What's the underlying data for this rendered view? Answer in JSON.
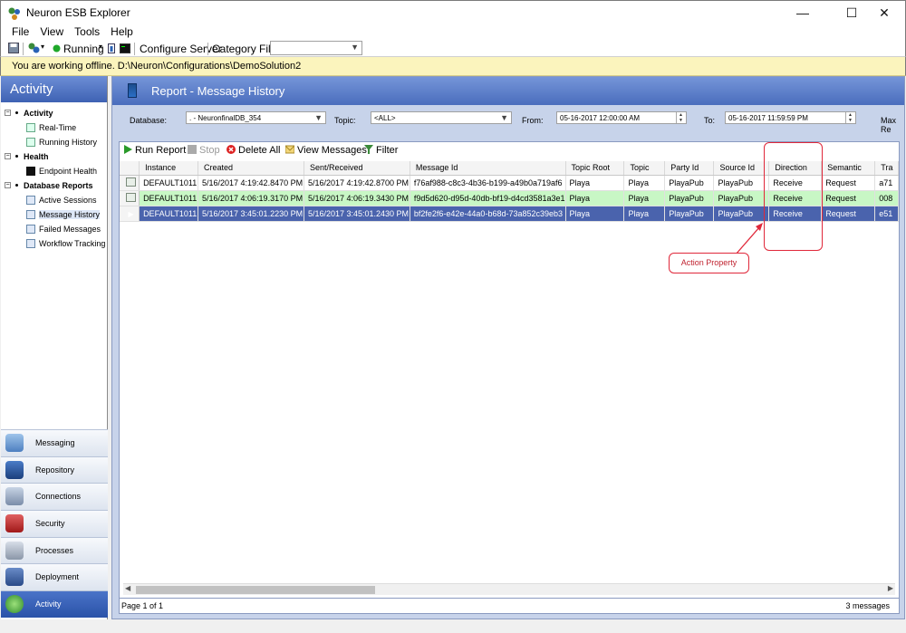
{
  "window": {
    "title": "Neuron ESB Explorer",
    "minimize": "—",
    "maximize": "☐",
    "close": "✕"
  },
  "menu": [
    "File",
    "View",
    "Tools",
    "Help"
  ],
  "toolbar": {
    "status": "Running",
    "configure_server": "Configure Server",
    "category_filter": "Category Filter",
    "category_value": ""
  },
  "offline_banner": "You are working offline. D:\\Neuron\\Configurations\\DemoSolution2",
  "nav": {
    "header": "Activity",
    "groups": [
      {
        "label": "Activity",
        "items": [
          "Real-Time",
          "Running History"
        ]
      },
      {
        "label": "Health",
        "items": [
          "Endpoint Health"
        ]
      },
      {
        "label": "Database Reports",
        "items": [
          "Active Sessions",
          "Message History",
          "Failed Messages",
          "Workflow Tracking"
        ]
      }
    ],
    "buttons": [
      "Messaging",
      "Repository",
      "Connections",
      "Security",
      "Processes",
      "Deployment",
      "Activity"
    ]
  },
  "report": {
    "title": "Report - Message History",
    "database_label": "Database:",
    "database_value": ". - NeuronfinalDB_354",
    "topic_label": "Topic:",
    "topic_value": "<ALL>",
    "from_label": "From:",
    "from_value": "05-16-2017 12:00:00 AM",
    "to_label": "To:",
    "to_value": "05-16-2017 11:59:59 PM",
    "max_label": "Max Re",
    "actions": {
      "run": "Run Report",
      "stop": "Stop",
      "delete": "Delete All",
      "view": "View Messages",
      "filter": "Filter"
    },
    "columns": [
      "Instance",
      "Created",
      "Sent/Received",
      "Message Id",
      "Topic Root",
      "Topic",
      "Party Id",
      "Source Id",
      "Direction",
      "Semantic",
      "Tra"
    ],
    "rows": [
      [
        "DEFAULT1011",
        "5/16/2017 4:19:42.8470 PM",
        "5/16/2017 4:19:42.8700 PM",
        "f76af988-c8c3-4b36-b199-a49b0a719af6",
        "Playa",
        "Playa",
        "PlayaPub",
        "PlayaPub",
        "Receive",
        "Request",
        "a71"
      ],
      [
        "DEFAULT1011",
        "5/16/2017 4:06:19.3170 PM",
        "5/16/2017 4:06:19.3430 PM",
        "f9d5d620-d95d-40db-bf19-d4cd3581a3e1",
        "Playa",
        "Playa",
        "PlayaPub",
        "PlayaPub",
        "Receive",
        "Request",
        "008"
      ],
      [
        "DEFAULT1011",
        "5/16/2017 3:45:01.2230 PM",
        "5/16/2017 3:45:01.2430 PM",
        "bf2fe2f6-e42e-44a0-b68d-73a852c39eb3",
        "Playa",
        "Playa",
        "PlayaPub",
        "PlayaPub",
        "Receive",
        "Request",
        "e51"
      ]
    ],
    "page_info": "Page 1 of 1",
    "count": "3 messages"
  },
  "annotation": {
    "callout": "Action Property"
  },
  "colors": {
    "accent": "#4a6dbd",
    "selected_row": "#4a63ad",
    "green_row": "#c8f7c5",
    "annotation": "#e0283a"
  }
}
